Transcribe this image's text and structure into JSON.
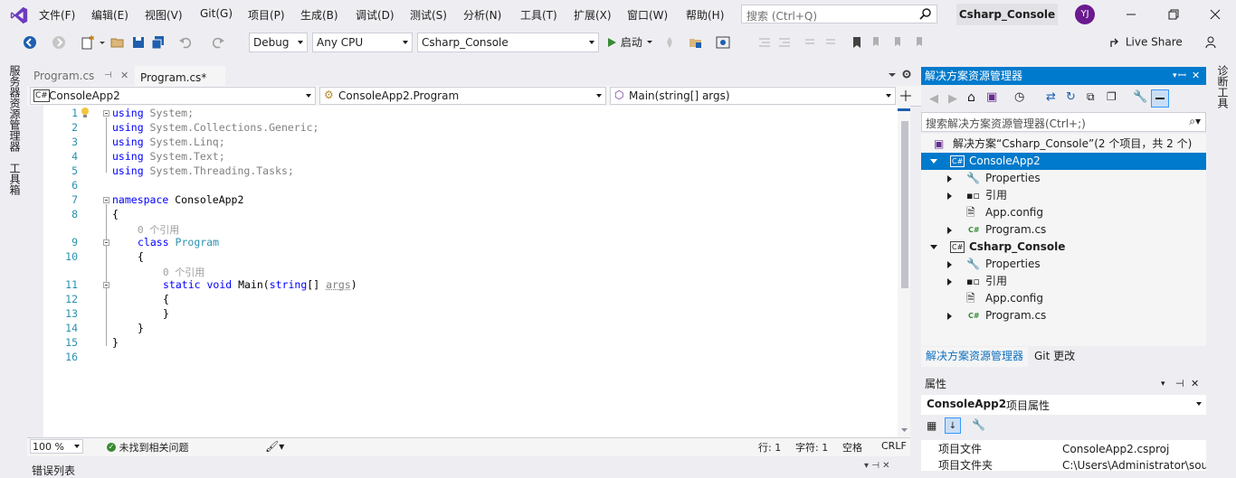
{
  "menu": {
    "items": [
      "文件(F)",
      "编辑(E)",
      "视图(V)",
      "Git(G)",
      "项目(P)",
      "生成(B)",
      "调试(D)",
      "测试(S)",
      "分析(N)",
      "工具(T)",
      "扩展(X)",
      "窗口(W)",
      "帮助(H)"
    ],
    "search_placeholder": "搜索 (Ctrl+Q)",
    "project_name": "Csharp_Console",
    "avatar_initials": "YJ"
  },
  "toolbar": {
    "config": "Debug",
    "platform": "Any CPU",
    "startup_project": "Csharp_Console",
    "start_label": "启动",
    "live_share": "Live Share"
  },
  "left_strip": {
    "server_explorer": "服务器资源管理器",
    "toolbox": "工具箱"
  },
  "right_strip": {
    "diagnostics": "诊断工具"
  },
  "tabs": [
    {
      "label": "Program.cs",
      "active": false
    },
    {
      "label": "Program.cs*",
      "active": true
    }
  ],
  "navbar": {
    "project": "ConsoleApp2",
    "type": "ConsoleApp2.Program",
    "member": "Main(string[] args)"
  },
  "editor": {
    "line_numbers": [
      "1",
      "2",
      "3",
      "4",
      "5",
      "6",
      "7",
      "8",
      "9",
      "10",
      "11",
      "12",
      "13",
      "14",
      "15",
      "16"
    ],
    "lines": [
      {
        "kw": "using",
        "rest": " System;"
      },
      {
        "kw": "using",
        "rest": " System.Collections.Generic;"
      },
      {
        "kw": "using",
        "rest": " System.Linq;"
      },
      {
        "kw": "using",
        "rest": " System.Text;"
      },
      {
        "kw": "using",
        "rest": " System.Threading.Tasks;"
      }
    ],
    "namespace_kw": "namespace",
    "namespace_name": " ConsoleApp2",
    "open_brace": "{",
    "close_brace": "}",
    "ref_hint_class": "0 个引用",
    "class_kw": "class",
    "class_name": " Program",
    "ref_hint_method": "0 个引用",
    "static_kw": "static",
    "void_kw": "void",
    "main_name": " Main(",
    "string_kw": "string",
    "args_text": "[] ",
    "args_name": "args",
    "close_paren": ")"
  },
  "status": {
    "zoom": "100 %",
    "issues": "未找到相关问题",
    "line": "行: 1",
    "col": "字符: 1",
    "ws": "空格",
    "eol": "CRLF"
  },
  "bottom_panel_title": "错误列表",
  "solution_explorer": {
    "title": "解决方案资源管理器",
    "search_placeholder": "搜索解决方案资源管理器(Ctrl+;)",
    "tree": [
      {
        "label": "解决方案“Csharp_Console”(2 个项目，共 2 个)",
        "level": 0,
        "selected": false,
        "bold": false
      },
      {
        "label": "ConsoleApp2",
        "level": 1,
        "selected": true,
        "bold": false
      },
      {
        "label": "Properties",
        "level": 2,
        "selected": false,
        "bold": false
      },
      {
        "label": "引用",
        "level": 2,
        "selected": false,
        "bold": false
      },
      {
        "label": "App.config",
        "level": 2,
        "selected": false,
        "bold": false
      },
      {
        "label": "Program.cs",
        "level": 2,
        "selected": false,
        "bold": false
      },
      {
        "label": "Csharp_Console",
        "level": 1,
        "selected": false,
        "bold": true
      },
      {
        "label": "Properties",
        "level": 2,
        "selected": false,
        "bold": false
      },
      {
        "label": "引用",
        "level": 2,
        "selected": false,
        "bold": false
      },
      {
        "label": "App.config",
        "level": 2,
        "selected": false,
        "bold": false
      },
      {
        "label": "Program.cs",
        "level": 2,
        "selected": false,
        "bold": false
      }
    ],
    "tab_active": "解决方案资源管理器",
    "tab_git": "Git 更改"
  },
  "properties": {
    "title": "属性",
    "selected_object": "ConsoleApp2",
    "selected_type": "项目属性",
    "rows": [
      {
        "name": "项目文件",
        "value": "ConsoleApp2.csproj"
      },
      {
        "name": "项目文件夹",
        "value": "C:\\Users\\Administrator\\sou"
      }
    ]
  },
  "colors": {
    "accent": "#007acc",
    "keyword": "#0000ff",
    "type": "#2b91af"
  }
}
